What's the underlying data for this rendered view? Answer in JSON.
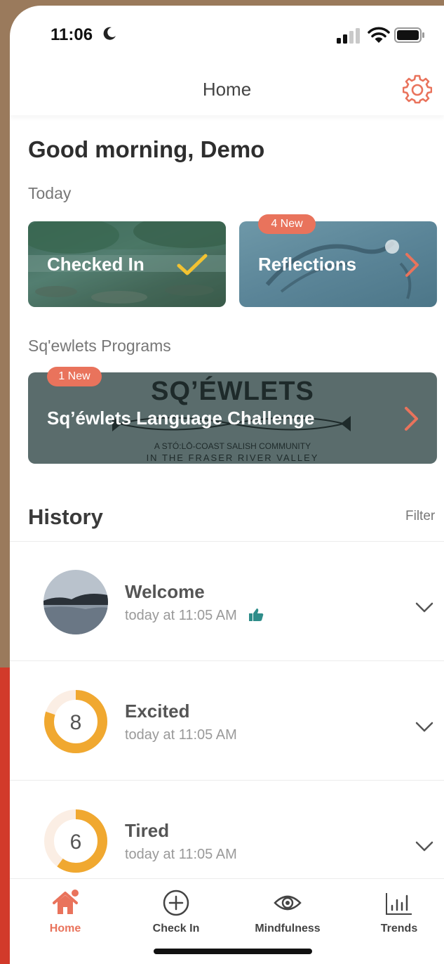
{
  "status_bar": {
    "time": "11:06"
  },
  "header": {
    "title": "Home"
  },
  "greeting": "Good morning, Demo",
  "today": {
    "label": "Today",
    "checked_in": {
      "label": "Checked In"
    },
    "reflections": {
      "label": "Reflections",
      "badge": "4 New"
    }
  },
  "programs": {
    "label": "Sq'ewlets Programs",
    "card": {
      "label": "Sq’éwlets Language Challenge",
      "badge": "1 New",
      "logo_title": "SQ’ÉWLETS",
      "logo_line1": "A STÓ:LŌ-COAST SALISH COMMUNITY",
      "logo_line2": "IN THE FRASER RIVER VALLEY"
    }
  },
  "history": {
    "title": "History",
    "filter": "Filter",
    "items": [
      {
        "title": "Welcome",
        "subtitle": "today at 11:05 AM"
      },
      {
        "title": "Excited",
        "subtitle": "today at 11:05 AM",
        "score": "8",
        "fraction": 0.8
      },
      {
        "title": "Tired",
        "subtitle": "today at 11:05 AM",
        "score": "6",
        "fraction": 0.6
      }
    ]
  },
  "tabs": [
    {
      "label": "Home",
      "active": true
    },
    {
      "label": "Check In"
    },
    {
      "label": "Mindfulness"
    },
    {
      "label": "Trends"
    }
  ],
  "colors": {
    "accent": "#e9735c",
    "ring": "#f0a830",
    "ring_track": "#fbeee4",
    "check": "#f2c231"
  }
}
